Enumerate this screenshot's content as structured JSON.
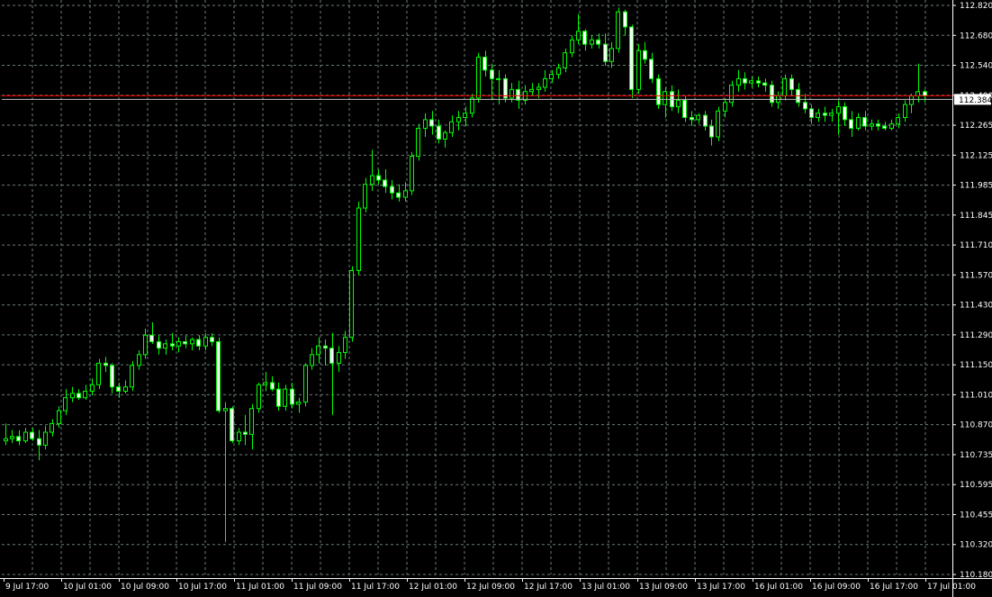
{
  "chart_data": {
    "type": "candlestick",
    "grid": true,
    "colors": {
      "background": "#000000",
      "grid": "#6b7b7b",
      "axis": "#ffffff",
      "candle_bull_body": "#000000",
      "candle_bear_body": "#ffffff",
      "candle_outline": "#00ff00",
      "bid_line": "#ff0000",
      "ask_line": "#c0c0c0",
      "price_tag_bg": "#ffffff",
      "text": "#ffffff"
    },
    "y_ticks": [
      "112.820",
      "112.680",
      "112.540",
      "112.400",
      "112.265",
      "112.125",
      "111.985",
      "111.845",
      "111.710",
      "111.570",
      "111.430",
      "111.290",
      "111.150",
      "111.010",
      "110.870",
      "110.735",
      "110.595",
      "110.455",
      "110.320",
      "110.180"
    ],
    "x_ticks": [
      "9 Jul 17:00",
      "10 Jul 01:00",
      "10 Jul 09:00",
      "10 Jul 17:00",
      "11 Jul 01:00",
      "11 Jul 09:00",
      "11 Jul 17:00",
      "12 Jul 01:00",
      "12 Jul 09:00",
      "12 Jul 17:00",
      "13 Jul 01:00",
      "13 Jul 09:00",
      "13 Jul 17:00",
      "16 Jul 01:00",
      "16 Jul 09:00",
      "16 Jul 17:00",
      "17 Jul 01:00"
    ],
    "ylim": [
      110.18,
      112.82
    ],
    "current_price": "112.384",
    "ohlc": [
      [
        110.8,
        110.88,
        110.78,
        110.81
      ],
      [
        110.81,
        110.85,
        110.79,
        110.82
      ],
      [
        110.82,
        110.85,
        110.78,
        110.8
      ],
      [
        110.8,
        110.86,
        110.79,
        110.84
      ],
      [
        110.84,
        110.86,
        110.8,
        110.81
      ],
      [
        110.81,
        110.85,
        110.71,
        110.78
      ],
      [
        110.78,
        110.87,
        110.76,
        110.84
      ],
      [
        110.84,
        110.9,
        110.82,
        110.88
      ],
      [
        110.88,
        110.96,
        110.86,
        110.94
      ],
      [
        110.94,
        111.04,
        110.92,
        111.0
      ],
      [
        111.0,
        111.05,
        110.98,
        111.02
      ],
      [
        111.02,
        111.04,
        110.99,
        111.0
      ],
      [
        111.0,
        111.06,
        110.99,
        111.03
      ],
      [
        111.03,
        111.09,
        111.01,
        111.06
      ],
      [
        111.06,
        111.18,
        111.04,
        111.16
      ],
      [
        111.16,
        111.19,
        111.12,
        111.15
      ],
      [
        111.15,
        111.16,
        111.02,
        111.05
      ],
      [
        111.05,
        111.07,
        111.0,
        111.03
      ],
      [
        111.03,
        111.08,
        111.02,
        111.05
      ],
      [
        111.05,
        111.17,
        111.03,
        111.15
      ],
      [
        111.15,
        111.22,
        111.13,
        111.2
      ],
      [
        111.2,
        111.32,
        111.18,
        111.29
      ],
      [
        111.29,
        111.35,
        111.25,
        111.26
      ],
      [
        111.26,
        111.29,
        111.2,
        111.23
      ],
      [
        111.23,
        111.27,
        111.2,
        111.25
      ],
      [
        111.25,
        111.3,
        111.22,
        111.24
      ],
      [
        111.24,
        111.28,
        111.21,
        111.26
      ],
      [
        111.26,
        111.29,
        111.23,
        111.25
      ],
      [
        111.25,
        111.28,
        111.22,
        111.27
      ],
      [
        111.27,
        111.29,
        111.22,
        111.24
      ],
      [
        111.24,
        111.3,
        111.22,
        111.28
      ],
      [
        111.28,
        111.3,
        111.24,
        111.26
      ],
      [
        111.26,
        111.28,
        110.93,
        110.94
      ],
      [
        110.94,
        110.98,
        110.33,
        110.95
      ],
      [
        110.95,
        110.96,
        110.79,
        110.8
      ],
      [
        110.8,
        110.86,
        110.78,
        110.84
      ],
      [
        110.84,
        110.92,
        110.78,
        110.83
      ],
      [
        110.83,
        110.97,
        110.76,
        110.95
      ],
      [
        110.95,
        111.07,
        110.93,
        111.06
      ],
      [
        111.06,
        111.12,
        111.03,
        111.07
      ],
      [
        111.07,
        111.1,
        111.03,
        111.04
      ],
      [
        111.04,
        111.07,
        110.94,
        110.96
      ],
      [
        110.96,
        111.06,
        110.94,
        111.04
      ],
      [
        111.04,
        111.07,
        110.95,
        110.97
      ],
      [
        110.97,
        111.0,
        110.93,
        110.98
      ],
      [
        110.98,
        111.16,
        110.96,
        111.15
      ],
      [
        111.15,
        111.23,
        111.13,
        111.2
      ],
      [
        111.2,
        111.28,
        111.16,
        111.24
      ],
      [
        111.24,
        111.27,
        111.15,
        111.23
      ],
      [
        111.23,
        111.3,
        110.92,
        111.16
      ],
      [
        111.16,
        111.24,
        111.12,
        111.21
      ],
      [
        111.21,
        111.31,
        111.18,
        111.28
      ],
      [
        111.28,
        111.61,
        111.26,
        111.59
      ],
      [
        111.59,
        111.91,
        111.57,
        111.88
      ],
      [
        111.88,
        112.02,
        111.86,
        111.99
      ],
      [
        111.99,
        112.15,
        111.96,
        112.03
      ],
      [
        112.03,
        112.06,
        111.99,
        112.01
      ],
      [
        112.01,
        112.06,
        111.95,
        111.98
      ],
      [
        111.98,
        112.01,
        111.92,
        111.95
      ],
      [
        111.95,
        111.99,
        111.91,
        111.93
      ],
      [
        111.93,
        112.0,
        111.91,
        111.96
      ],
      [
        111.96,
        112.14,
        111.94,
        112.12
      ],
      [
        112.12,
        112.27,
        112.1,
        112.25
      ],
      [
        112.25,
        112.32,
        112.21,
        112.29
      ],
      [
        112.29,
        112.33,
        112.22,
        112.26
      ],
      [
        112.26,
        112.29,
        112.18,
        112.2
      ],
      [
        112.2,
        112.24,
        112.16,
        112.23
      ],
      [
        112.23,
        112.31,
        112.21,
        112.28
      ],
      [
        112.28,
        112.33,
        112.24,
        112.3
      ],
      [
        112.3,
        112.35,
        112.26,
        112.32
      ],
      [
        112.32,
        112.41,
        112.3,
        112.39
      ],
      [
        112.39,
        112.6,
        112.37,
        112.58
      ],
      [
        112.58,
        112.61,
        112.49,
        112.52
      ],
      [
        112.52,
        112.55,
        112.38,
        112.48
      ],
      [
        112.48,
        112.52,
        112.36,
        112.48
      ],
      [
        112.48,
        112.5,
        112.37,
        112.39
      ],
      [
        112.39,
        112.46,
        112.37,
        112.43
      ],
      [
        112.43,
        112.47,
        112.34,
        112.38
      ],
      [
        112.38,
        112.45,
        112.36,
        112.42
      ],
      [
        112.42,
        112.46,
        112.4,
        112.43
      ],
      [
        112.43,
        112.46,
        112.39,
        112.44
      ],
      [
        112.44,
        112.52,
        112.42,
        112.48
      ],
      [
        112.48,
        112.52,
        112.46,
        112.5
      ],
      [
        112.5,
        112.55,
        112.48,
        112.53
      ],
      [
        112.53,
        112.62,
        112.51,
        112.6
      ],
      [
        112.6,
        112.68,
        112.58,
        112.66
      ],
      [
        112.66,
        112.78,
        112.64,
        112.7
      ],
      [
        112.7,
        112.71,
        112.61,
        112.64
      ],
      [
        112.64,
        112.68,
        112.62,
        112.66
      ],
      [
        112.66,
        112.69,
        112.62,
        112.64
      ],
      [
        112.64,
        112.69,
        112.54,
        112.56
      ],
      [
        112.56,
        112.65,
        112.53,
        112.62
      ],
      [
        112.62,
        112.81,
        112.6,
        112.79
      ],
      [
        112.79,
        112.8,
        112.68,
        112.72
      ],
      [
        112.72,
        112.73,
        112.39,
        112.43
      ],
      [
        112.43,
        112.64,
        112.41,
        112.61
      ],
      [
        112.61,
        112.65,
        112.55,
        112.57
      ],
      [
        112.57,
        112.6,
        112.46,
        112.48
      ],
      [
        112.48,
        112.5,
        112.34,
        112.36
      ],
      [
        112.36,
        112.44,
        112.3,
        112.42
      ],
      [
        112.42,
        112.45,
        112.33,
        112.35
      ],
      [
        112.35,
        112.43,
        112.32,
        112.38
      ],
      [
        112.38,
        112.4,
        112.28,
        112.3
      ],
      [
        112.3,
        112.33,
        112.26,
        112.29
      ],
      [
        112.29,
        112.32,
        112.27,
        112.31
      ],
      [
        112.31,
        112.33,
        112.24,
        112.26
      ],
      [
        112.26,
        112.29,
        112.17,
        112.21
      ],
      [
        112.21,
        112.35,
        112.19,
        112.33
      ],
      [
        112.33,
        112.39,
        112.3,
        112.37
      ],
      [
        112.37,
        112.47,
        112.35,
        112.45
      ],
      [
        112.45,
        112.52,
        112.42,
        112.48
      ],
      [
        112.48,
        112.51,
        112.43,
        112.46
      ],
      [
        112.46,
        112.49,
        112.44,
        112.47
      ],
      [
        112.47,
        112.49,
        112.44,
        112.46
      ],
      [
        112.46,
        112.48,
        112.42,
        112.45
      ],
      [
        112.45,
        112.47,
        112.35,
        112.37
      ],
      [
        112.37,
        112.42,
        112.34,
        112.4
      ],
      [
        112.4,
        112.5,
        112.38,
        112.48
      ],
      [
        112.48,
        112.5,
        112.4,
        112.43
      ],
      [
        112.43,
        112.46,
        112.35,
        112.37
      ],
      [
        112.37,
        112.41,
        112.32,
        112.34
      ],
      [
        112.34,
        112.36,
        112.27,
        112.3
      ],
      [
        112.3,
        112.34,
        112.28,
        112.32
      ],
      [
        112.32,
        112.35,
        112.28,
        112.31
      ],
      [
        112.31,
        112.34,
        112.28,
        112.32
      ],
      [
        112.32,
        112.38,
        112.22,
        112.35
      ],
      [
        112.35,
        112.37,
        112.26,
        112.29
      ],
      [
        112.29,
        112.33,
        112.21,
        112.25
      ],
      [
        112.25,
        112.32,
        112.24,
        112.3
      ],
      [
        112.3,
        112.33,
        112.24,
        112.26
      ],
      [
        112.26,
        112.29,
        112.24,
        112.27
      ],
      [
        112.27,
        112.29,
        112.24,
        112.26
      ],
      [
        112.26,
        112.28,
        112.24,
        112.25
      ],
      [
        112.25,
        112.29,
        112.24,
        112.27
      ],
      [
        112.27,
        112.32,
        112.25,
        112.3
      ],
      [
        112.3,
        112.38,
        112.28,
        112.36
      ],
      [
        112.36,
        112.41,
        112.32,
        112.4
      ],
      [
        112.4,
        112.55,
        112.37,
        112.42
      ],
      [
        112.42,
        112.43,
        112.37,
        112.4
      ]
    ]
  }
}
